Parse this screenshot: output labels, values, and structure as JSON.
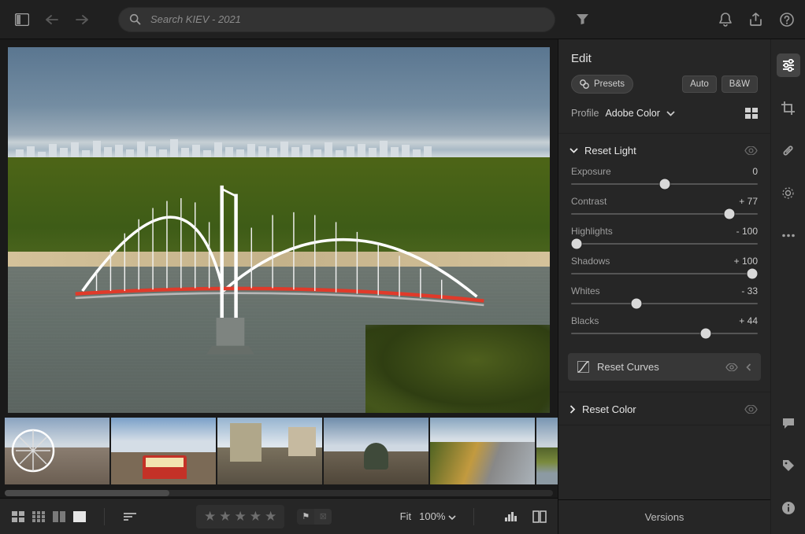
{
  "search": {
    "placeholder": "Search KIEV - 2021"
  },
  "edit": {
    "title": "Edit",
    "presets_label": "Presets",
    "auto_label": "Auto",
    "bw_label": "B&W",
    "profile_label": "Profile",
    "profile_value": "Adobe Color",
    "light_section": "Reset Light",
    "curves_label": "Reset Curves",
    "color_section": "Reset Color",
    "sliders": {
      "exposure": {
        "label": "Exposure",
        "value": "0",
        "knob": 50
      },
      "contrast": {
        "label": "Contrast",
        "value": "+ 77",
        "knob": 85
      },
      "highlights": {
        "label": "Highlights",
        "value": "- 100",
        "knob": 3
      },
      "shadows": {
        "label": "Shadows",
        "value": "+ 100",
        "knob": 97
      },
      "whites": {
        "label": "Whites",
        "value": "- 33",
        "knob": 35
      },
      "blacks": {
        "label": "Blacks",
        "value": "+ 44",
        "knob": 72
      }
    }
  },
  "bottombar": {
    "fit_label": "Fit",
    "zoom_label": "100%"
  },
  "versions_label": "Versions"
}
